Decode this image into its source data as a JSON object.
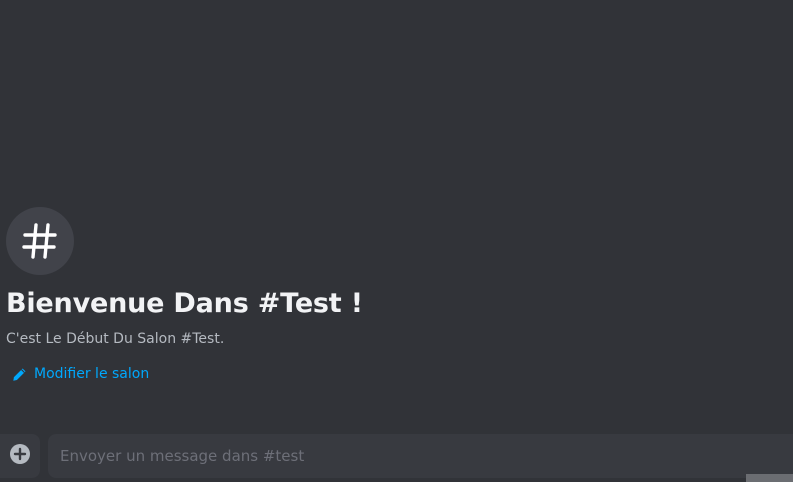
{
  "welcome": {
    "icon": "hashtag-icon",
    "title": "Bienvenue Dans #Test !",
    "subtitle": "C'est Le Début Du Salon #Test.",
    "edit_link": {
      "icon": "pencil-icon",
      "label": "Modifier le salon"
    }
  },
  "composer": {
    "attach_icon": "plus-circle-icon",
    "placeholder": "Envoyer un message dans #test",
    "value": ""
  },
  "colors": {
    "background": "#313338",
    "badge": "#41434a",
    "input_background": "#383a40",
    "title": "#f2f3f5",
    "subtitle": "#b5bac1",
    "link": "#00a8fc",
    "placeholder": "#6d6f78"
  }
}
